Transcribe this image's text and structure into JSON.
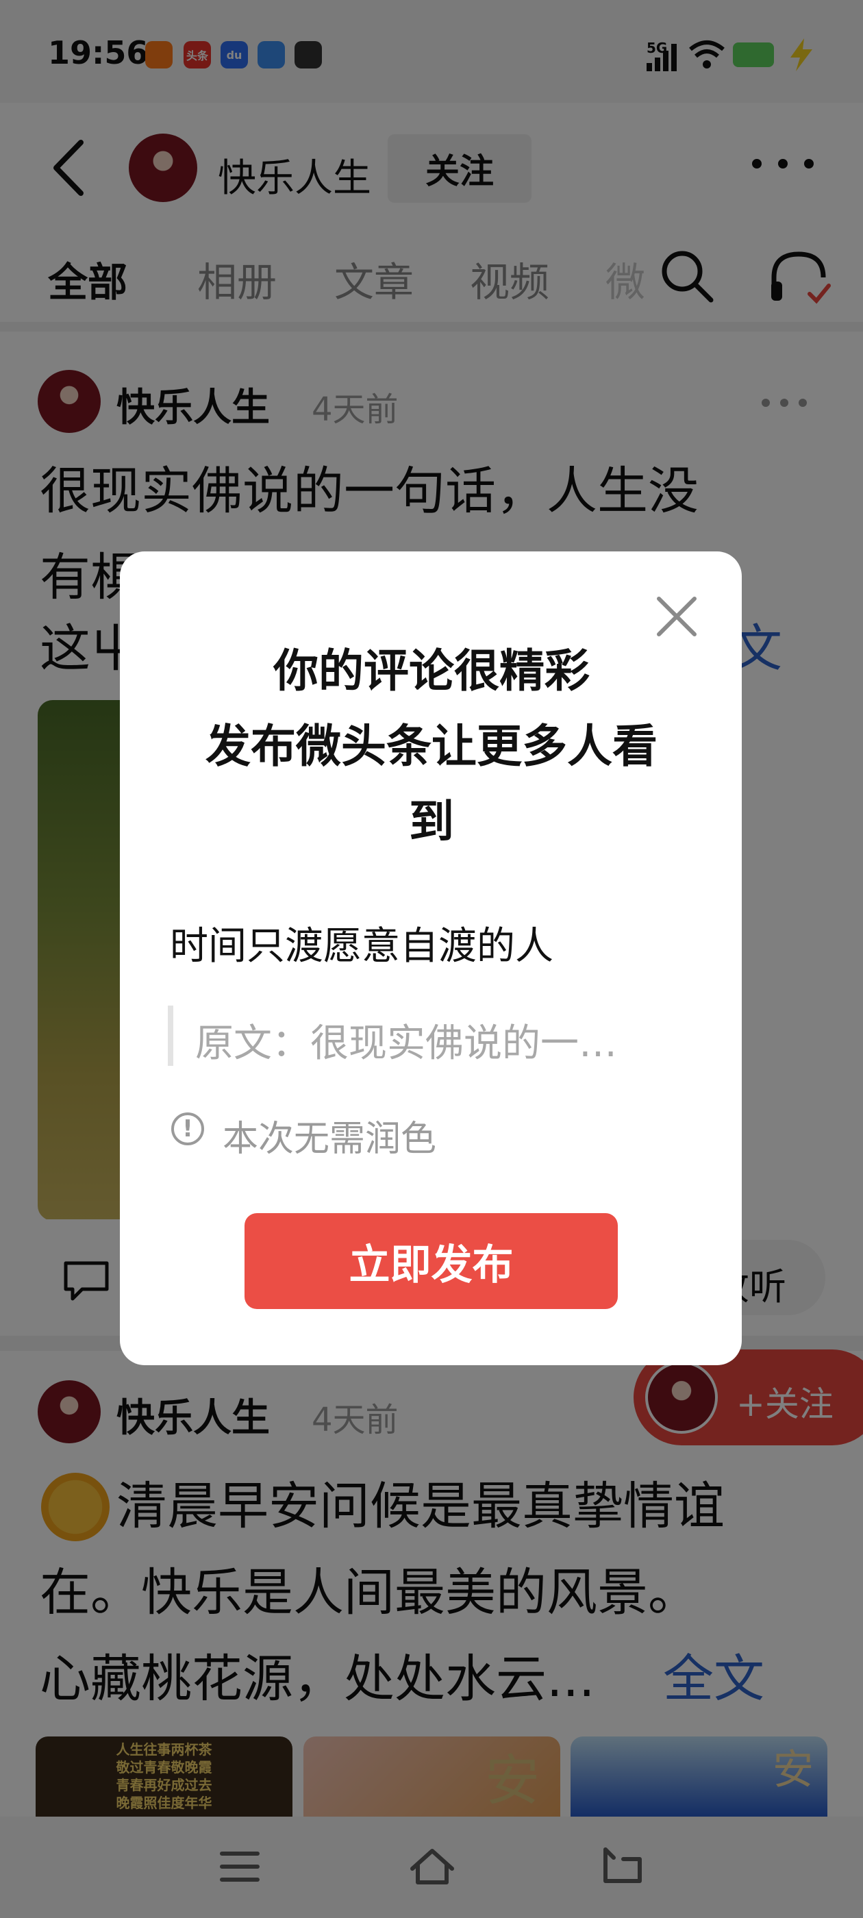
{
  "status_bar": {
    "time": "19:56",
    "app_icons": [
      "kuaishou-app-icon",
      "toutiao-app-icon",
      "baidu-app-icon",
      "docs-app-icon",
      "game-app-icon"
    ],
    "app_badge_text": [
      "",
      "头条",
      "du",
      "",
      ""
    ],
    "network": "5G",
    "icons": [
      "signal-icon",
      "wifi-icon",
      "battery-icon",
      "charging-icon"
    ]
  },
  "header": {
    "back_icon": "back-arrow-icon",
    "username": "快乐人生",
    "follow_label": "关注",
    "more_icon": "more-dots-icon"
  },
  "tabs": {
    "items": [
      "全部",
      "相册",
      "文章",
      "视频",
      "微"
    ],
    "active": "全部",
    "search_icon": "search-icon",
    "listen_icon": "headphones-icon"
  },
  "post1": {
    "author": "快乐人生",
    "time": "4天前",
    "lines": [
      "很现实佛说的一句话，人生没",
      "有椇",
      "这屮"
    ],
    "more_text": "文",
    "listen_label": "收听"
  },
  "post2": {
    "author": "快乐人生",
    "time": "4天前",
    "lines": [
      "清晨早安问候是最真挚情谊",
      "在。快乐是人间最美的风景。",
      "心藏桃花源，处处水云..."
    ],
    "more_text": "全文",
    "thumb_texts": [
      "人生往事两杯茶\n敬过青春敬晚霞\n青春再好成过去\n晚霞照佳度年华",
      "安",
      "安"
    ]
  },
  "floating_follow": {
    "label": "+关注"
  },
  "dialog": {
    "title_lines": [
      "你的评论很精彩",
      "发布微头条让更多人看",
      "到"
    ],
    "comment_text": "时间只渡愿意自渡的人",
    "original_text": "原文：很现实佛说的一…",
    "hint_text": "本次无需润色",
    "publish_label": "立即发布",
    "close_icon": "close-icon",
    "info_icon": "info-icon"
  },
  "navbar": {
    "icons": [
      "menu-icon",
      "home-icon",
      "back-icon"
    ]
  },
  "colors": {
    "accent_red": "#eb4e45",
    "link_blue": "#2f62c8",
    "overlay": "rgba(0,0,0,0.5)"
  }
}
